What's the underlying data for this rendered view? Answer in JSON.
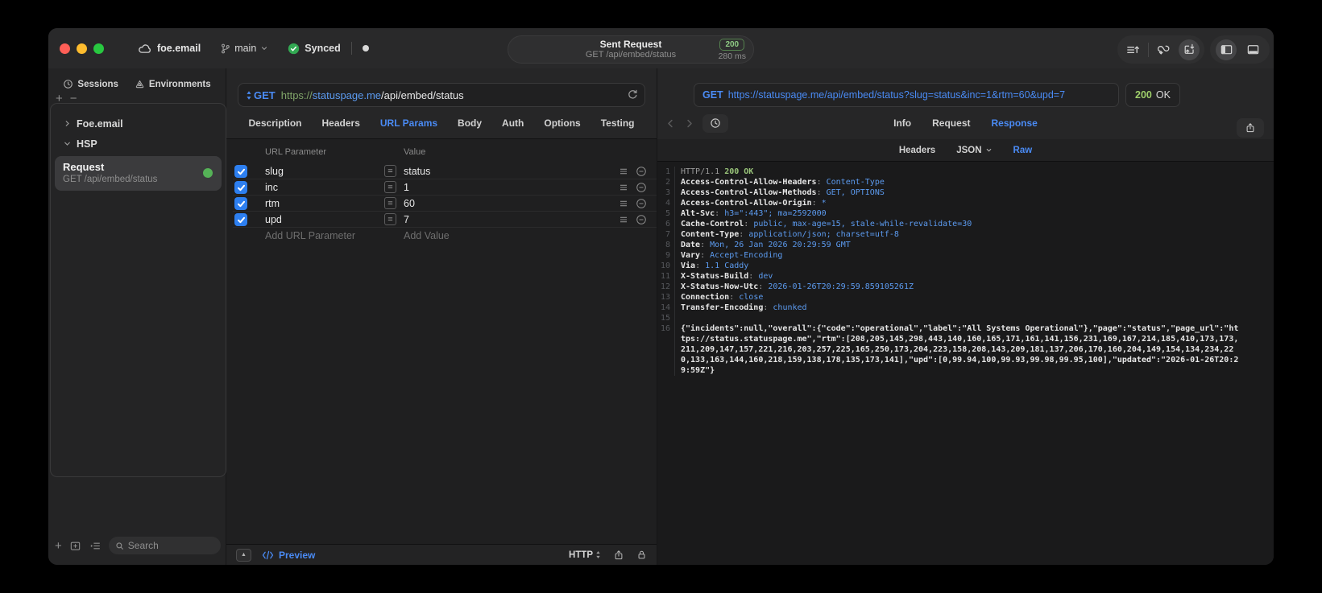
{
  "icons": {
    "plus": "+",
    "minus": "−",
    "equals": "=",
    "triangle_up": "▲"
  },
  "titlebar": {
    "project": "foe.email",
    "branch": "main",
    "sync_status": "Synced",
    "request_title": "Sent Request",
    "request_subtitle": "GET /api/embed/status",
    "status_badge": "200",
    "duration": "280 ms"
  },
  "sidebar": {
    "tabs": [
      "Sessions",
      "Environments"
    ],
    "groups": [
      {
        "label": "Foe.email",
        "expanded": false
      },
      {
        "label": "HSP",
        "expanded": true
      }
    ],
    "request_item": {
      "title": "Request",
      "subtitle": "GET /api/embed/status"
    },
    "search_placeholder": "Search"
  },
  "request_panel": {
    "method": "GET",
    "url_scheme": "https://",
    "url_host": "statuspage.me",
    "url_path": "/api/embed/status",
    "tabs": [
      {
        "label": "Description",
        "active": false
      },
      {
        "label": "Headers",
        "active": false
      },
      {
        "label": "URL Params",
        "active": true
      },
      {
        "label": "Body",
        "active": false
      },
      {
        "label": "Auth",
        "active": false
      },
      {
        "label": "Options",
        "active": false
      },
      {
        "label": "Testing",
        "active": false
      }
    ],
    "table": {
      "col_param": "URL Parameter",
      "col_value": "Value",
      "rows": [
        {
          "name": "slug",
          "value": "status",
          "checked": true
        },
        {
          "name": "inc",
          "value": "1",
          "checked": true
        },
        {
          "name": "rtm",
          "value": "60",
          "checked": true
        },
        {
          "name": "upd",
          "value": "7",
          "checked": true
        }
      ],
      "add_param_placeholder": "Add URL Parameter",
      "add_value_placeholder": "Add Value"
    },
    "footer": {
      "preview_label": "Preview",
      "http_label": "HTTP"
    }
  },
  "response_panel": {
    "method": "GET",
    "request_url": "https://statuspage.me/api/embed/status?slug=status&inc=1&rtm=60&upd=7",
    "status_code": "200",
    "status_text": "OK",
    "tabs": [
      {
        "label": "Info",
        "active": false
      },
      {
        "label": "Request",
        "active": false
      },
      {
        "label": "Response",
        "active": true
      }
    ],
    "subtabs": [
      "Headers",
      "JSON",
      "Raw"
    ],
    "active_subtab": "Raw",
    "code": {
      "status": {
        "num": "1",
        "version": "HTTP/1.1",
        "text": "200 OK"
      },
      "headers": [
        {
          "num": "2",
          "name": "Access-Control-Allow-Headers",
          "value": "Content-Type"
        },
        {
          "num": "3",
          "name": "Access-Control-Allow-Methods",
          "value": "GET, OPTIONS"
        },
        {
          "num": "4",
          "name": "Access-Control-Allow-Origin",
          "value": "*"
        },
        {
          "num": "5",
          "name": "Alt-Svc",
          "value": "h3=\":443\"; ma=2592000"
        },
        {
          "num": "6",
          "name": "Cache-Control",
          "value": "public, max-age=15, stale-while-revalidate=30"
        },
        {
          "num": "7",
          "name": "Content-Type",
          "value": "application/json; charset=utf-8"
        },
        {
          "num": "8",
          "name": "Date",
          "value": "Mon, 26 Jan 2026 20:29:59 GMT"
        },
        {
          "num": "9",
          "name": "Vary",
          "value": "Accept-Encoding"
        },
        {
          "num": "10",
          "name": "Via",
          "value": "1.1 Caddy"
        },
        {
          "num": "11",
          "name": "X-Status-Build",
          "value": "dev"
        },
        {
          "num": "12",
          "name": "X-Status-Now-Utc",
          "value": "2026-01-26T20:29:59.859105261Z"
        },
        {
          "num": "13",
          "name": "Connection",
          "value": "close"
        },
        {
          "num": "14",
          "name": "Transfer-Encoding",
          "value": "chunked"
        }
      ],
      "blank_num": "15",
      "body_num": "16",
      "body": "{\"incidents\":null,\"overall\":{\"code\":\"operational\",\"label\":\"All Systems Operational\"},\"page\":\"status\",\"page_url\":\"https://status.statuspage.me\",\"rtm\":[208,205,145,298,443,140,160,165,171,161,141,156,231,169,167,214,185,410,173,173,211,209,147,157,221,216,203,257,225,165,250,173,204,223,158,208,143,209,181,137,206,170,160,204,149,154,134,234,220,133,163,144,160,218,159,138,178,135,173,141],\"upd\":[0,99.94,100,99.93,99.98,99.95,100],\"updated\":\"2026-01-26T20:29:59Z\"}"
    }
  },
  "colors": {
    "accent_blue": "#4a8bf5",
    "code_blue": "#5c9bf0",
    "green": "#98c379",
    "checkbox_blue": "#2d7ff0"
  }
}
